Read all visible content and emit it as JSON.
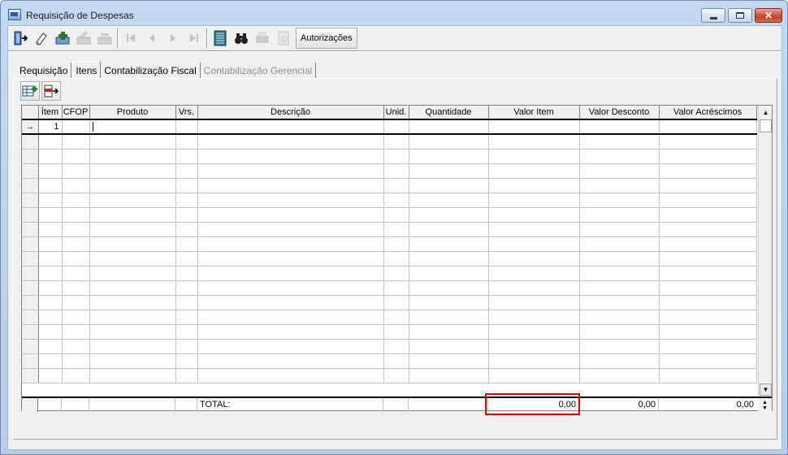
{
  "window": {
    "title": "Requisição de Despesas"
  },
  "toolbar": {
    "buttons": [
      {
        "icon": "exit-door-icon",
        "enabled": true
      },
      {
        "icon": "eraser-icon",
        "enabled": true
      },
      {
        "icon": "new-record-icon",
        "enabled": true
      },
      {
        "icon": "edit-record-icon",
        "enabled": false
      },
      {
        "icon": "delete-record-icon",
        "enabled": false
      },
      {
        "icon": "first-record-icon",
        "enabled": false
      },
      {
        "icon": "previous-record-icon",
        "enabled": false
      },
      {
        "icon": "next-record-icon",
        "enabled": false
      },
      {
        "icon": "last-record-icon",
        "enabled": false
      },
      {
        "icon": "grid-view-icon",
        "enabled": true
      },
      {
        "icon": "binoculars-icon",
        "enabled": true
      },
      {
        "icon": "print-icon",
        "enabled": false
      },
      {
        "icon": "preview-icon",
        "enabled": false
      }
    ],
    "autorizacoes_label": "Autorizações"
  },
  "tabs": [
    {
      "label": "Requisição",
      "state": "normal"
    },
    {
      "label": "Itens",
      "state": "active"
    },
    {
      "label": "Contabilização Fiscal",
      "state": "normal"
    },
    {
      "label": "Contabilização Gerencial",
      "state": "disabled"
    }
  ],
  "panel_tools": [
    {
      "icon": "add-item-icon"
    },
    {
      "icon": "remove-item-icon"
    }
  ],
  "grid": {
    "columns": [
      "Ítem",
      "CFOP",
      "Produto",
      "Vrs.",
      "Descrição",
      "Unid.",
      "Quantidade",
      "Valor Item",
      "Valor Desconto",
      "Valor Acréscimos"
    ],
    "rows": [
      {
        "indicator": "→",
        "item": "1",
        "cfop": "",
        "produto": "",
        "vrs": "",
        "descricao": "",
        "unid": "",
        "quantidade": "",
        "valor_item": "",
        "valor_desconto": "",
        "valor_acrescimos": ""
      }
    ],
    "totals": {
      "label": "TOTAL:",
      "valor_item": "0,00",
      "valor_desconto": "0,00",
      "valor_acrescimos": "0,00"
    }
  },
  "colors": {
    "highlight_border": "#e00000",
    "titlebar": "#c3d9ee"
  }
}
